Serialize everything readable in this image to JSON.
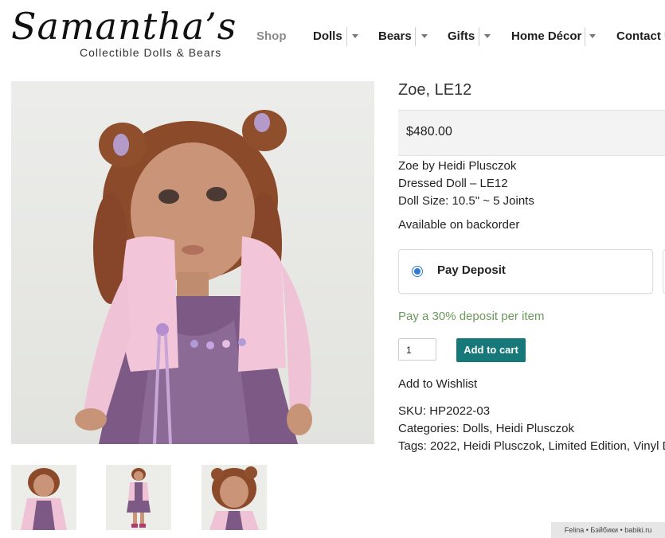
{
  "header": {
    "logo_script": "Samantha’s",
    "logo_tagline": "Collectible Dolls & Bears",
    "nav": [
      {
        "label": "Shop"
      },
      {
        "label": "Dolls"
      },
      {
        "label": "Bears"
      },
      {
        "label": "Gifts"
      },
      {
        "label": "Home Décor"
      },
      {
        "label": "Contact U"
      }
    ]
  },
  "product": {
    "title": "Zoe, LE12",
    "price": "$480.00",
    "description": [
      "Zoe by Heidi Plusczok",
      "Dressed Doll – LE12",
      "Doll Size: 10.5\" ~ 5 Joints"
    ],
    "availability": "Available on backorder",
    "deposit_option": "Pay Deposit",
    "deposit_note": "Pay a 30% deposit per item",
    "quantity": "1",
    "add_to_cart": "Add to cart",
    "wishlist": "Add to Wishlist",
    "sku_label": "SKU:",
    "sku": "HP2022-03",
    "categories_label": "Categories:",
    "categories": [
      "Dolls",
      "Heidi Plusczok"
    ],
    "tags_label": "Tags:",
    "tags": [
      "2022",
      "Heidi Plusczok",
      "Limited Edition",
      "Vinyl D"
    ]
  },
  "watermark": "Felina • Бэйбики • babiki.ru"
}
